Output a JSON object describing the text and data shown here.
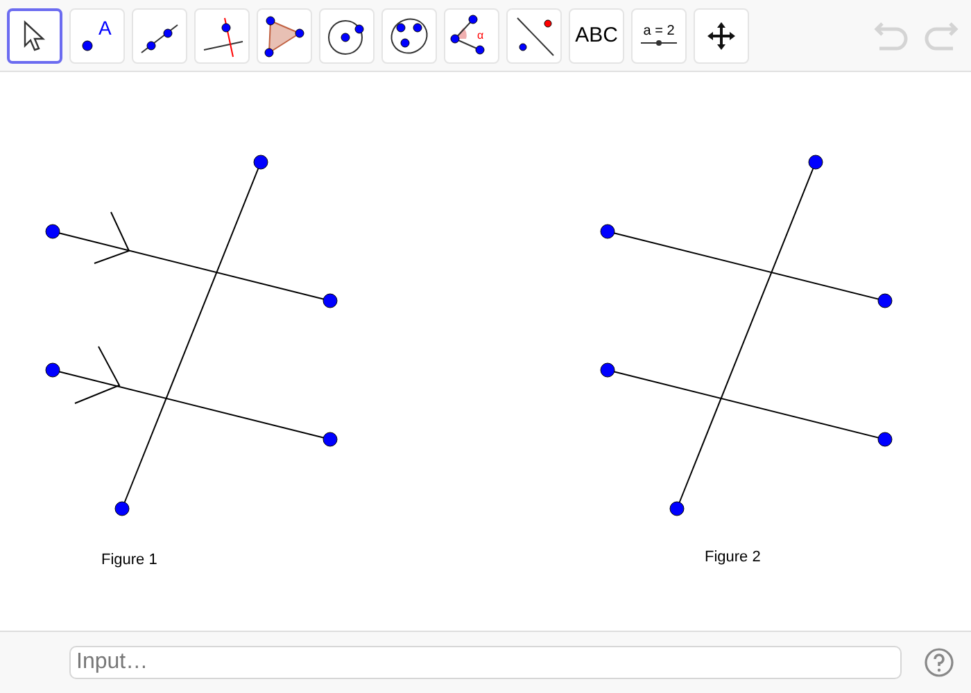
{
  "toolbar": {
    "tools": [
      {
        "kind": "move",
        "selected": true
      },
      {
        "kind": "point",
        "label": "A",
        "selected": false
      },
      {
        "kind": "line",
        "selected": false
      },
      {
        "kind": "perpendicular",
        "selected": false
      },
      {
        "kind": "polygon",
        "selected": false
      },
      {
        "kind": "circle",
        "selected": false
      },
      {
        "kind": "conic",
        "selected": false
      },
      {
        "kind": "angle",
        "label": "α",
        "selected": false
      },
      {
        "kind": "reflect",
        "selected": false
      },
      {
        "kind": "text",
        "label": "ABC",
        "selected": false
      },
      {
        "kind": "slider",
        "label": "a = 2",
        "selected": false
      },
      {
        "kind": "pan",
        "selected": false
      }
    ],
    "undo": {
      "disabled": true
    },
    "redo": {
      "disabled": true
    }
  },
  "graphics": {
    "captions": [
      "Figure 1",
      "Figure 2"
    ]
  },
  "input_bar": {
    "placeholder": "Input…"
  }
}
